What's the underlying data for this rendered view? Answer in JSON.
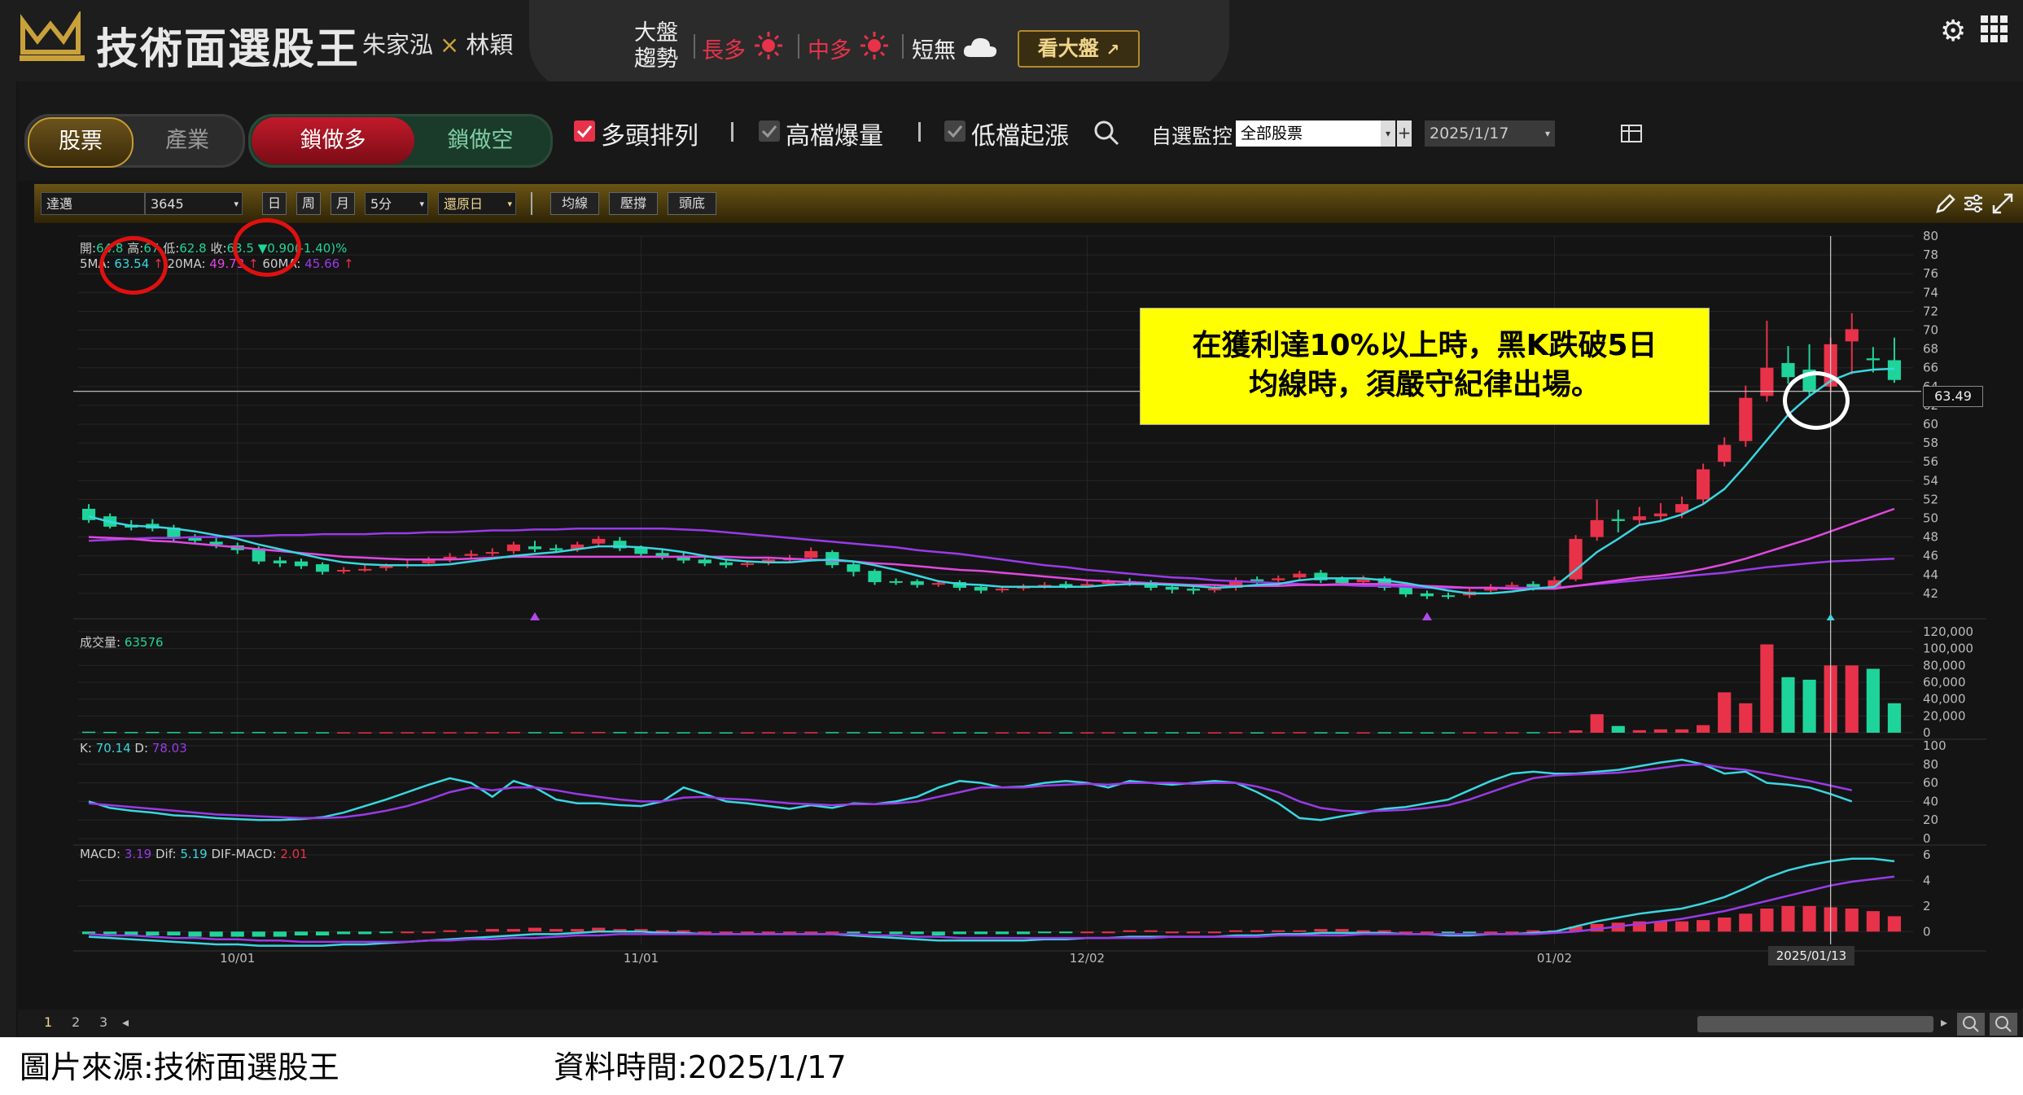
{
  "header": {
    "app_title": "技術面選股王",
    "author1": "朱家泓",
    "author_sep": "×",
    "author2": "林穎",
    "market_label_line1": "大盤",
    "market_label_line2": "趨勢",
    "trend_long": "長多",
    "trend_mid": "中多",
    "trend_short": "短無",
    "view_market_label": "看大盤"
  },
  "toolbar": {
    "tab_stock": "股票",
    "tab_industry": "產業",
    "mode_long": "鎖做多",
    "mode_short": "鎖做空",
    "filter1": "多頭排列",
    "filter2": "高檔爆量",
    "filter3": "低檔起漲",
    "watch_label": "自選監控",
    "watch_value": "全部股票",
    "date_value": "2025/1/17"
  },
  "chart_toolbar": {
    "stock_name": "達邁",
    "stock_code": "3645",
    "period_day": "日",
    "period_week": "周",
    "period_month": "月",
    "interval": "5分",
    "restore": "還原日",
    "btn_ma": "均線",
    "btn_sr": "壓撐",
    "btn_tb": "頭底"
  },
  "info": {
    "open_label": "開:",
    "open_value": "64.8",
    "high_label": "高:",
    "high_value": "67",
    "low_label": "低:",
    "low_value": "62.8",
    "close_label": "收:",
    "close_value": "63.5",
    "change": "▼0.90(-1.40)%",
    "ma5_label": "5MA:",
    "ma5_value": "63.54",
    "ma20_label": "20MA:",
    "ma20_value": "49.73",
    "ma60_label": "60MA:",
    "ma60_value": "45.66",
    "vol_label": "成交量:",
    "vol_value": "63576",
    "k_label": "K:",
    "k_value": "70.14",
    "d_label": "D:",
    "d_value": "78.03",
    "macd_label": "MACD:",
    "macd_value": "3.19",
    "dif_label": "Dif:",
    "dif_value": "5.19",
    "osc_label": "DIF-MACD:",
    "osc_value": "2.01",
    "cursor_price": "63.49",
    "cursor_date": "2025/01/13"
  },
  "callout": {
    "line1": "在獲利達10%以上時，黑K跌破5日",
    "line2": "均線時，須嚴守紀律出場。"
  },
  "pager": [
    "1",
    "2",
    "3"
  ],
  "footer": {
    "source": "圖片來源:技術面選股王",
    "datatime": "資料時間:2025/1/17"
  },
  "colors": {
    "up": "#e8324a",
    "down": "#1fd49a",
    "ma5": "#3ad6e0",
    "ma20": "#e048e0",
    "ma60": "#9a3ae8",
    "gold": "#c9a13b",
    "callout": "#ffff00"
  },
  "icons": [
    "logo-icon",
    "sun-icon",
    "cloud-icon",
    "search-icon",
    "gear-icon",
    "grid-icon",
    "table-icon",
    "pencil-icon",
    "settings-icon",
    "expand-icon",
    "zoom-out-icon",
    "zoom-in-icon"
  ],
  "chart_data": {
    "type": "candlestick",
    "price_axis": {
      "ylim": [
        40,
        80
      ],
      "ticks": [
        80,
        78,
        76,
        74,
        72,
        70,
        68,
        66,
        64,
        62,
        60,
        58,
        56,
        54,
        52,
        50,
        48,
        46,
        44,
        42
      ]
    },
    "volume_axis": {
      "ylim": [
        0,
        120000
      ],
      "ticks": [
        "120,000",
        "100,000",
        "80,000",
        "60,000",
        "40,000",
        "20,000",
        "0"
      ]
    },
    "kd_axis": {
      "ylim": [
        0,
        100
      ],
      "ticks": [
        100,
        80,
        60,
        40,
        20,
        0
      ]
    },
    "macd_axis": {
      "ylim": [
        -1,
        6
      ],
      "ticks": [
        6,
        4,
        2,
        0
      ]
    },
    "x_labels": [
      {
        "index": 7,
        "label": "10/01"
      },
      {
        "index": 26,
        "label": "11/01"
      },
      {
        "index": 47,
        "label": "12/02"
      },
      {
        "index": 69,
        "label": "01/02"
      }
    ],
    "candles": [
      [
        51.0,
        49.8,
        51.5,
        49.5
      ],
      [
        50.2,
        49.1,
        50.5,
        48.9
      ],
      [
        49.3,
        49.0,
        49.8,
        48.7
      ],
      [
        49.4,
        48.9,
        49.9,
        48.6
      ],
      [
        49.0,
        47.8,
        49.3,
        47.5
      ],
      [
        47.9,
        47.6,
        48.3,
        47.2
      ],
      [
        47.5,
        47.2,
        47.9,
        46.8
      ],
      [
        47.1,
        46.6,
        47.4,
        46.2
      ],
      [
        46.8,
        45.4,
        47.0,
        45.1
      ],
      [
        45.5,
        45.2,
        45.9,
        44.8
      ],
      [
        45.4,
        44.9,
        45.7,
        44.6
      ],
      [
        45.1,
        44.3,
        45.3,
        44.0
      ],
      [
        44.4,
        44.5,
        44.8,
        44.1
      ],
      [
        44.6,
        44.6,
        45.0,
        44.3
      ],
      [
        44.7,
        44.9,
        45.2,
        44.4
      ],
      [
        45.0,
        45.1,
        45.5,
        44.7
      ],
      [
        45.2,
        45.5,
        45.9,
        44.9
      ],
      [
        45.6,
        45.9,
        46.3,
        45.3
      ],
      [
        46.0,
        46.2,
        46.6,
        45.6
      ],
      [
        46.3,
        46.4,
        46.8,
        46.0
      ],
      [
        46.5,
        47.2,
        47.5,
        46.2
      ],
      [
        47.0,
        46.7,
        47.6,
        46.4
      ],
      [
        46.8,
        46.6,
        47.2,
        46.3
      ],
      [
        46.7,
        47.2,
        47.5,
        46.4
      ],
      [
        47.3,
        47.8,
        48.1,
        47.0
      ],
      [
        47.6,
        46.8,
        48.0,
        46.5
      ],
      [
        46.9,
        46.2,
        47.1,
        45.9
      ],
      [
        46.3,
        45.9,
        46.7,
        45.6
      ],
      [
        46.0,
        45.5,
        46.4,
        45.2
      ],
      [
        45.6,
        45.2,
        45.9,
        44.9
      ],
      [
        45.3,
        45.0,
        45.6,
        44.7
      ],
      [
        45.1,
        45.2,
        45.5,
        44.8
      ],
      [
        45.3,
        45.6,
        45.9,
        45.0
      ],
      [
        45.7,
        45.7,
        46.1,
        45.3
      ],
      [
        45.8,
        46.5,
        46.9,
        45.5
      ],
      [
        46.4,
        45.0,
        46.6,
        44.7
      ],
      [
        45.1,
        44.3,
        45.3,
        43.8
      ],
      [
        44.4,
        43.2,
        44.6,
        42.9
      ],
      [
        43.3,
        43.2,
        43.6,
        42.9
      ],
      [
        43.3,
        42.9,
        43.5,
        42.6
      ],
      [
        43.0,
        43.1,
        43.4,
        42.7
      ],
      [
        43.2,
        42.6,
        43.4,
        42.3
      ],
      [
        42.7,
        42.3,
        43.0,
        42.0
      ],
      [
        42.4,
        42.5,
        42.8,
        42.1
      ],
      [
        42.6,
        42.7,
        43.0,
        42.3
      ],
      [
        42.8,
        42.9,
        43.2,
        42.5
      ],
      [
        43.0,
        42.8,
        43.3,
        42.5
      ],
      [
        42.9,
        43.0,
        43.3,
        42.6
      ],
      [
        43.1,
        43.2,
        43.5,
        42.8
      ],
      [
        43.3,
        43.1,
        43.6,
        42.8
      ],
      [
        43.2,
        42.6,
        43.4,
        42.3
      ],
      [
        42.7,
        42.4,
        43.0,
        42.0
      ],
      [
        42.5,
        42.3,
        42.8,
        41.9
      ],
      [
        42.4,
        42.5,
        42.8,
        42.1
      ],
      [
        42.6,
        43.4,
        43.7,
        42.3
      ],
      [
        43.5,
        43.3,
        43.8,
        43.0
      ],
      [
        43.4,
        43.6,
        43.9,
        43.1
      ],
      [
        43.7,
        44.1,
        44.4,
        43.4
      ],
      [
        44.2,
        43.4,
        44.5,
        43.1
      ],
      [
        43.5,
        43.1,
        43.8,
        42.8
      ],
      [
        43.2,
        43.5,
        43.9,
        42.9
      ],
      [
        43.6,
        42.6,
        43.8,
        42.3
      ],
      [
        42.7,
        41.9,
        43.0,
        41.6
      ],
      [
        42.0,
        41.7,
        42.3,
        41.4
      ],
      [
        41.8,
        41.7,
        42.1,
        41.4
      ],
      [
        41.8,
        42.2,
        42.5,
        41.5
      ],
      [
        42.3,
        42.7,
        43.0,
        42.0
      ],
      [
        42.8,
        42.9,
        43.2,
        42.5
      ],
      [
        43.0,
        42.6,
        43.3,
        42.3
      ],
      [
        42.7,
        43.4,
        43.8,
        42.4
      ],
      [
        43.5,
        47.8,
        48.2,
        43.3
      ],
      [
        48.0,
        49.8,
        52.0,
        47.6
      ],
      [
        49.9,
        49.7,
        50.9,
        48.5
      ],
      [
        49.8,
        50.2,
        51.2,
        49.4
      ],
      [
        50.2,
        50.5,
        51.6,
        49.8
      ],
      [
        50.6,
        51.5,
        52.3,
        50.0
      ],
      [
        52.0,
        55.2,
        55.8,
        51.6
      ],
      [
        56.0,
        57.8,
        58.6,
        55.5
      ],
      [
        58.2,
        62.8,
        64.1,
        57.6
      ],
      [
        63.0,
        66.0,
        71.0,
        62.4
      ],
      [
        66.5,
        65.0,
        68.3,
        64.3
      ],
      [
        65.8,
        63.5,
        68.5,
        62.9
      ],
      [
        64.0,
        68.5,
        69.2,
        63.4
      ],
      [
        68.8,
        70.1,
        71.8,
        65.3
      ],
      [
        67.0,
        66.8,
        68.2,
        65.5
      ],
      [
        66.8,
        64.7,
        69.2,
        64.4
      ]
    ],
    "ma5": [
      50.2,
      49.6,
      49.2,
      49.1,
      48.9,
      48.6,
      48.2,
      47.8,
      47.2,
      46.7,
      46.2,
      45.7,
      45.3,
      45.1,
      45.0,
      45.0,
      45.0,
      45.1,
      45.4,
      45.7,
      46.0,
      46.2,
      46.4,
      46.7,
      47.0,
      47.0,
      46.9,
      46.7,
      46.4,
      46.0,
      45.6,
      45.4,
      45.3,
      45.3,
      45.5,
      45.6,
      45.4,
      45.0,
      44.5,
      43.9,
      43.3,
      43.0,
      42.9,
      42.7,
      42.7,
      42.7,
      42.7,
      42.7,
      42.9,
      43.0,
      43.0,
      42.9,
      42.8,
      42.6,
      42.7,
      42.9,
      43.0,
      43.4,
      43.6,
      43.6,
      43.6,
      43.4,
      43.1,
      42.7,
      42.3,
      42.0,
      42.0,
      42.2,
      42.5,
      42.7,
      44.5,
      46.4,
      47.8,
      49.3,
      49.7,
      50.4,
      51.5,
      53.1,
      55.6,
      58.3,
      61.0,
      63.0,
      64.6,
      65.5,
      65.8,
      65.9
    ],
    "ma20": [
      48.0,
      47.9,
      47.8,
      47.6,
      47.5,
      47.3,
      47.1,
      46.9,
      46.7,
      46.5,
      46.3,
      46.1,
      45.9,
      45.8,
      45.7,
      45.6,
      45.6,
      45.6,
      45.7,
      45.8,
      45.9,
      45.9,
      45.9,
      45.9,
      45.9,
      45.9,
      45.9,
      45.9,
      45.9,
      45.9,
      45.9,
      45.8,
      45.8,
      45.7,
      45.6,
      45.5,
      45.4,
      45.2,
      45.1,
      44.9,
      44.7,
      44.5,
      44.4,
      44.2,
      44.0,
      43.8,
      43.6,
      43.4,
      43.3,
      43.2,
      43.1,
      43.0,
      42.9,
      42.9,
      42.8,
      42.8,
      42.8,
      42.9,
      42.9,
      43.0,
      43.0,
      43.0,
      42.9,
      42.8,
      42.7,
      42.6,
      42.6,
      42.5,
      42.5,
      42.5,
      42.8,
      43.1,
      43.4,
      43.7,
      43.9,
      44.2,
      44.6,
      45.1,
      45.7,
      46.4,
      47.1,
      47.8,
      48.6,
      49.4,
      50.2,
      51.0
    ],
    "ma60": [
      47.6,
      47.7,
      47.8,
      47.9,
      47.9,
      48.0,
      48.0,
      48.1,
      48.1,
      48.2,
      48.2,
      48.3,
      48.3,
      48.3,
      48.4,
      48.4,
      48.5,
      48.5,
      48.6,
      48.7,
      48.7,
      48.8,
      48.8,
      48.9,
      48.9,
      48.9,
      48.9,
      48.9,
      48.8,
      48.7,
      48.5,
      48.3,
      48.1,
      47.9,
      47.7,
      47.5,
      47.3,
      47.1,
      46.9,
      46.6,
      46.4,
      46.2,
      45.9,
      45.6,
      45.3,
      45.0,
      44.8,
      44.5,
      44.3,
      44.1,
      43.9,
      43.7,
      43.6,
      43.4,
      43.3,
      43.2,
      43.1,
      43.0,
      42.9,
      42.9,
      42.8,
      42.8,
      42.7,
      42.6,
      42.6,
      42.6,
      42.6,
      42.6,
      42.6,
      42.6,
      42.8,
      43.0,
      43.2,
      43.4,
      43.6,
      43.8,
      44.0,
      44.2,
      44.5,
      44.8,
      45.0,
      45.2,
      45.4,
      45.5,
      45.6,
      45.7
    ],
    "volume": [
      1200,
      1000,
      900,
      1000,
      900,
      800,
      800,
      700,
      900,
      700,
      600,
      600,
      500,
      500,
      600,
      600,
      700,
      600,
      600,
      700,
      800,
      700,
      600,
      700,
      900,
      800,
      700,
      600,
      600,
      500,
      500,
      500,
      600,
      500,
      700,
      800,
      700,
      900,
      600,
      600,
      600,
      600,
      500,
      500,
      600,
      600,
      500,
      500,
      600,
      500,
      600,
      600,
      500,
      500,
      600,
      500,
      500,
      700,
      600,
      500,
      500,
      600,
      700,
      500,
      500,
      600,
      700,
      600,
      700,
      900,
      2800,
      22000,
      8000,
      3000,
      4000,
      4000,
      9000,
      48000,
      35000,
      105000,
      66000,
      63000,
      80000,
      80000,
      76000,
      35000
    ],
    "k": [
      40,
      33,
      30,
      28,
      25,
      24,
      22,
      21,
      20,
      20,
      21,
      23,
      28,
      35,
      42,
      50,
      58,
      65,
      60,
      45,
      62,
      55,
      42,
      38,
      38,
      36,
      35,
      40,
      55,
      48,
      40,
      38,
      35,
      32,
      36,
      33,
      38,
      37,
      40,
      45,
      55,
      62,
      60,
      55,
      56,
      60,
      62,
      60,
      55,
      62,
      60,
      58,
      60,
      62,
      60,
      50,
      38,
      22,
      20,
      24,
      28,
      32,
      34,
      38,
      42,
      52,
      62,
      70,
      72,
      70,
      70,
      72,
      74,
      78,
      82,
      85,
      80,
      70,
      72,
      60,
      58,
      55,
      48,
      40
    ],
    "d": [
      38,
      36,
      34,
      32,
      30,
      28,
      26,
      25,
      24,
      23,
      22,
      22,
      23,
      26,
      30,
      35,
      42,
      50,
      55,
      52,
      55,
      55,
      52,
      48,
      45,
      42,
      40,
      40,
      44,
      45,
      43,
      42,
      40,
      38,
      37,
      36,
      37,
      37,
      38,
      40,
      45,
      50,
      55,
      55,
      55,
      57,
      58,
      59,
      58,
      60,
      60,
      60,
      59,
      60,
      60,
      56,
      50,
      40,
      33,
      30,
      29,
      30,
      31,
      33,
      36,
      42,
      50,
      58,
      65,
      68,
      69,
      70,
      71,
      73,
      76,
      79,
      80,
      76,
      74,
      70,
      66,
      62,
      57,
      52
    ],
    "dif": [
      -0.4,
      -0.5,
      -0.6,
      -0.7,
      -0.8,
      -0.9,
      -1.0,
      -1.0,
      -1.1,
      -1.1,
      -1.1,
      -1.1,
      -1.0,
      -1.0,
      -0.9,
      -0.8,
      -0.7,
      -0.6,
      -0.5,
      -0.4,
      -0.3,
      -0.2,
      -0.2,
      -0.1,
      0.0,
      0.0,
      0.0,
      -0.1,
      -0.1,
      -0.2,
      -0.2,
      -0.2,
      -0.2,
      -0.2,
      -0.2,
      -0.2,
      -0.3,
      -0.4,
      -0.5,
      -0.6,
      -0.7,
      -0.7,
      -0.7,
      -0.7,
      -0.7,
      -0.6,
      -0.6,
      -0.5,
      -0.5,
      -0.4,
      -0.4,
      -0.4,
      -0.4,
      -0.4,
      -0.3,
      -0.3,
      -0.2,
      -0.2,
      -0.1,
      -0.1,
      -0.1,
      -0.1,
      -0.2,
      -0.2,
      -0.3,
      -0.3,
      -0.2,
      -0.2,
      -0.1,
      0.0,
      0.4,
      0.8,
      1.1,
      1.4,
      1.6,
      1.8,
      2.2,
      2.7,
      3.4,
      4.2,
      4.8,
      5.2,
      5.5,
      5.7,
      5.7,
      5.5
    ],
    "macd": [
      -0.2,
      -0.3,
      -0.3,
      -0.4,
      -0.5,
      -0.5,
      -0.6,
      -0.6,
      -0.7,
      -0.7,
      -0.8,
      -0.8,
      -0.8,
      -0.8,
      -0.8,
      -0.8,
      -0.7,
      -0.7,
      -0.6,
      -0.6,
      -0.5,
      -0.5,
      -0.4,
      -0.3,
      -0.3,
      -0.2,
      -0.2,
      -0.2,
      -0.2,
      -0.2,
      -0.2,
      -0.2,
      -0.2,
      -0.2,
      -0.2,
      -0.2,
      -0.2,
      -0.3,
      -0.3,
      -0.4,
      -0.4,
      -0.5,
      -0.5,
      -0.5,
      -0.5,
      -0.5,
      -0.5,
      -0.5,
      -0.5,
      -0.5,
      -0.5,
      -0.4,
      -0.4,
      -0.4,
      -0.4,
      -0.4,
      -0.3,
      -0.3,
      -0.3,
      -0.3,
      -0.2,
      -0.2,
      -0.2,
      -0.2,
      -0.2,
      -0.2,
      -0.2,
      -0.2,
      -0.2,
      -0.1,
      0.0,
      0.2,
      0.4,
      0.6,
      0.8,
      1.0,
      1.3,
      1.6,
      2.0,
      2.4,
      2.8,
      3.2,
      3.6,
      3.9,
      4.1,
      4.3
    ],
    "markers": [
      {
        "index": 21,
        "kind": "triangle"
      },
      {
        "index": 63,
        "kind": "triangle"
      }
    ],
    "cursor_index": 82
  }
}
